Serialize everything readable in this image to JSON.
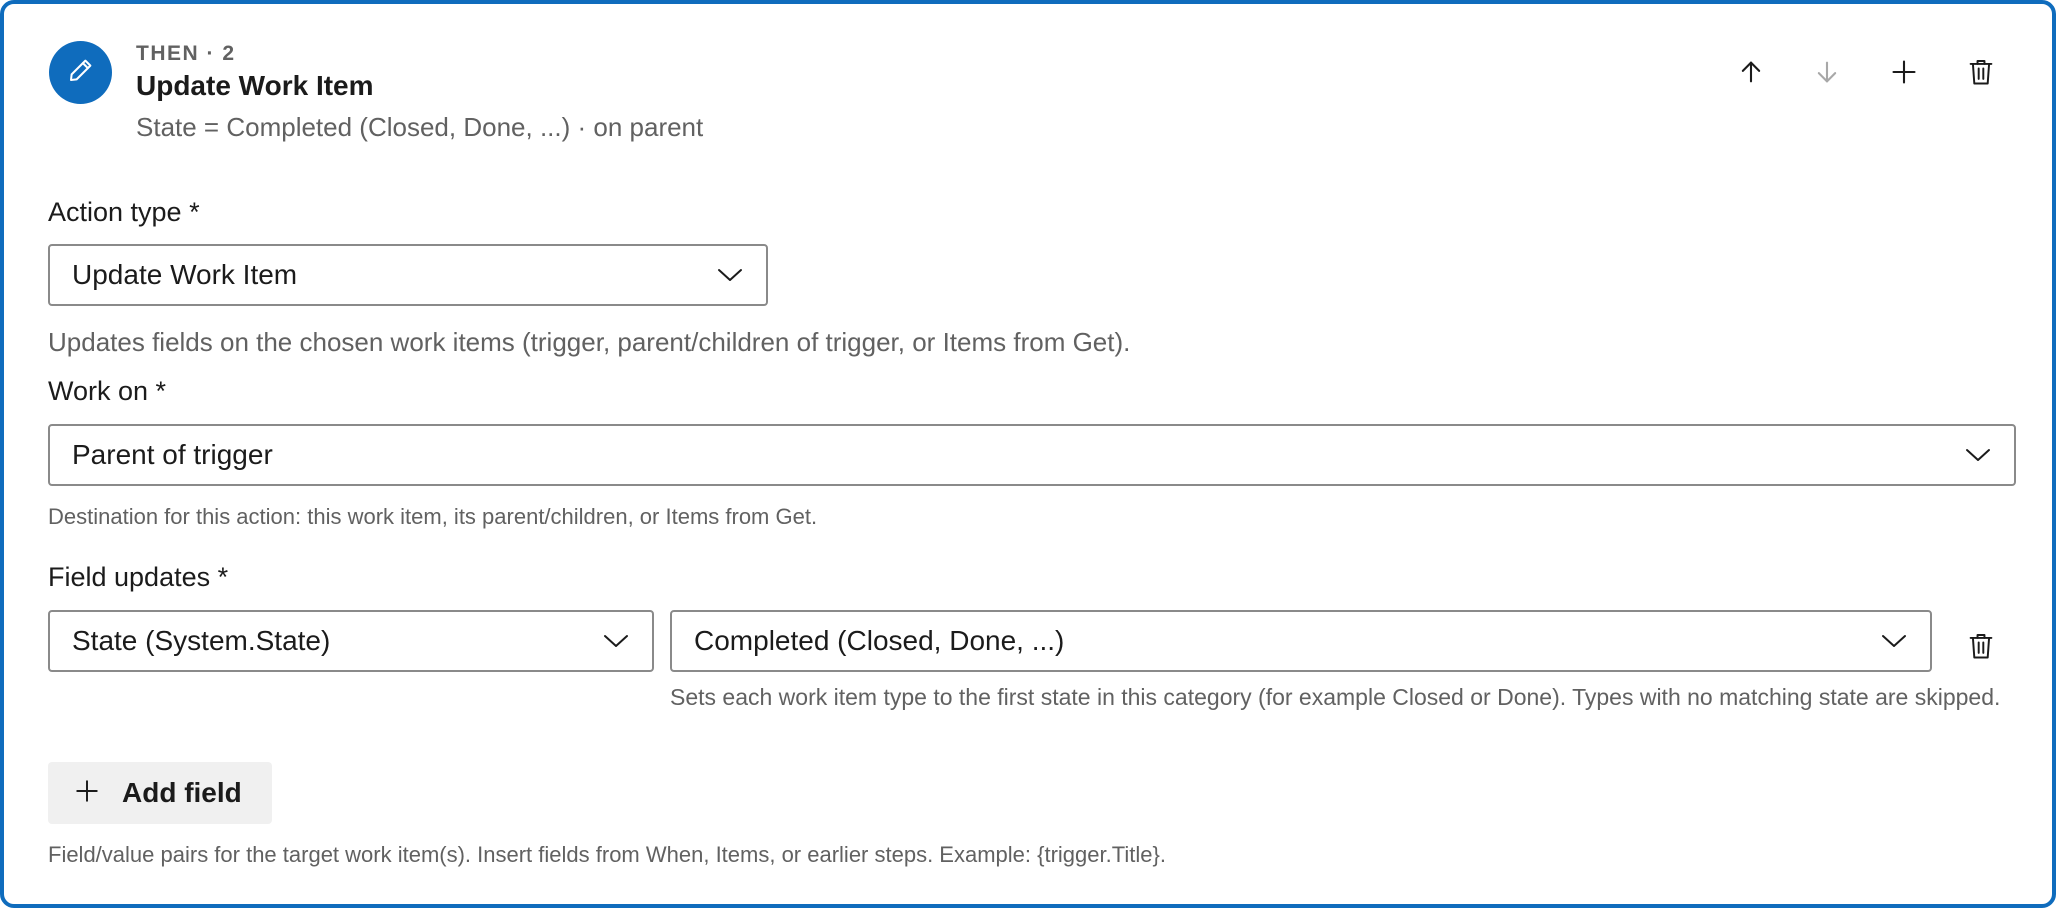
{
  "step": {
    "eyebrow": "THEN · 2",
    "title": "Update Work Item",
    "summary": "State = Completed (Closed, Done, ...) · on parent",
    "icon": "pencil-icon",
    "accent_color": "#0f6cbd"
  },
  "toolbar": {
    "icons": [
      "arrow-up-icon",
      "arrow-down-icon",
      "plus-icon",
      "trash-icon"
    ],
    "move_down_disabled": true
  },
  "action_type": {
    "label": "Action type *",
    "value": "Update Work Item",
    "help": "Updates fields on the chosen work items (trigger, parent/children of trigger, or Items from Get)."
  },
  "work_on": {
    "label": "Work on *",
    "value": "Parent of trigger",
    "help": "Destination for this action: this work item, its parent/children, or Items from Get."
  },
  "field_updates": {
    "label": "Field updates *",
    "rows": [
      {
        "field": "State (System.State)",
        "value": "Completed (Closed, Done, ...)",
        "help": "Sets each work item type to the first state in this category (for example Closed or Done). Types with no matching state are skipped."
      }
    ],
    "add_label": "Add field",
    "help": "Field/value pairs for the target work item(s). Insert fields from When, Items, or earlier steps. Example: {trigger.Title}."
  }
}
